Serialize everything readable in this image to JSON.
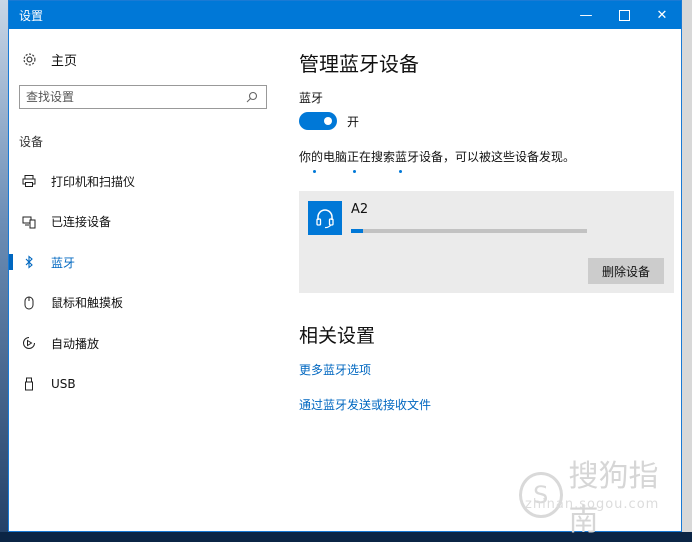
{
  "window": {
    "title": "设置"
  },
  "titlebar": {
    "minimize": "—",
    "close": "✕"
  },
  "sidebar": {
    "home_label": "主页",
    "search_placeholder": "查找设置",
    "group_label": "设备",
    "items": [
      {
        "label": "打印机和扫描仪",
        "icon": "printer-icon",
        "active": false
      },
      {
        "label": "已连接设备",
        "icon": "connected-devices-icon",
        "active": false
      },
      {
        "label": "蓝牙",
        "icon": "bluetooth-icon",
        "active": true
      },
      {
        "label": "鼠标和触摸板",
        "icon": "mouse-icon",
        "active": false
      },
      {
        "label": "自动播放",
        "icon": "autoplay-icon",
        "active": false
      },
      {
        "label": "USB",
        "icon": "usb-icon",
        "active": false
      }
    ]
  },
  "main": {
    "heading": "管理蓝牙设备",
    "bluetooth_label": "蓝牙",
    "toggle_state": "开",
    "searching_text": "你的电脑正在搜索蓝牙设备，可以被这些设备发现。",
    "device": {
      "name": "A2",
      "icon": "headset-icon",
      "progress": 0.05,
      "remove_label": "删除设备"
    },
    "related_heading": "相关设置",
    "links": [
      "更多蓝牙选项",
      "通过蓝牙发送或接收文件"
    ]
  },
  "watermark": {
    "text": "搜狗指南",
    "url": "zhinan.sogou.com"
  },
  "colors": {
    "accent": "#0078d7",
    "link": "#0067c0",
    "card": "#ebebeb"
  }
}
